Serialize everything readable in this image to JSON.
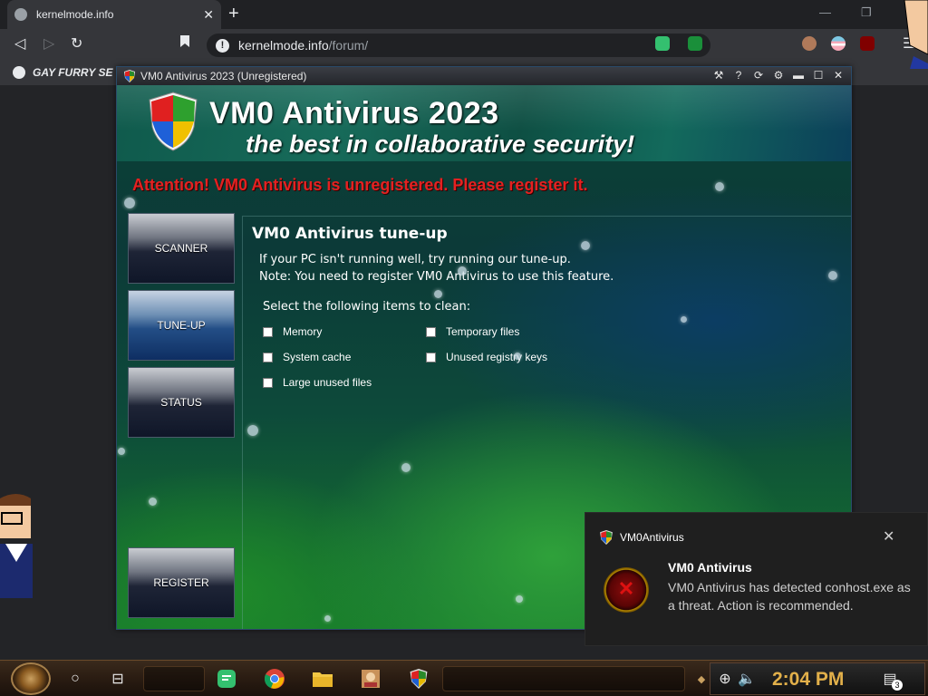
{
  "browser": {
    "tab_title": "kernelmode.info",
    "url_host": "kernelmode.info",
    "url_path": "/forum/",
    "bookmark_label": "GAY FURRY SE",
    "new_tab_symbol": "+"
  },
  "av_window": {
    "window_title": "VM0 Antivirus 2023 (Unregistered)",
    "brand_title": "VM0 Antivirus 2023",
    "tagline": "the best in collaborative security!",
    "warning": "Attention! VM0 Antivirus is unregistered. Please register it.",
    "nav": [
      {
        "label": "SCANNER"
      },
      {
        "label": "TUNE-UP"
      },
      {
        "label": "STATUS"
      },
      {
        "label": "REGISTER"
      }
    ],
    "panel": {
      "heading": "VM0 Antivirus tune-up",
      "line1": "If your PC isn't running well, try running our tune-up.",
      "line2": "Note: You need to register VM0 Antivirus to use this feature.",
      "select_label": "Select the following items to clean:",
      "items": [
        {
          "label": "Memory"
        },
        {
          "label": "Temporary files"
        },
        {
          "label": "System cache"
        },
        {
          "label": "Unused registry keys"
        },
        {
          "label": "Large unused files"
        }
      ]
    }
  },
  "toast": {
    "app_name": "VM0Antivirus",
    "title": "VM0 Antivirus",
    "message": "VM0 Antivirus has detected conhost.exe as a threat. Action is recommended."
  },
  "taskbar": {
    "time": "2:04 PM",
    "notification_count": "3"
  },
  "colors": {
    "warning_red": "#e42121",
    "clock_gold": "#e2b04a",
    "toast_bg": "#1f1f1f"
  }
}
